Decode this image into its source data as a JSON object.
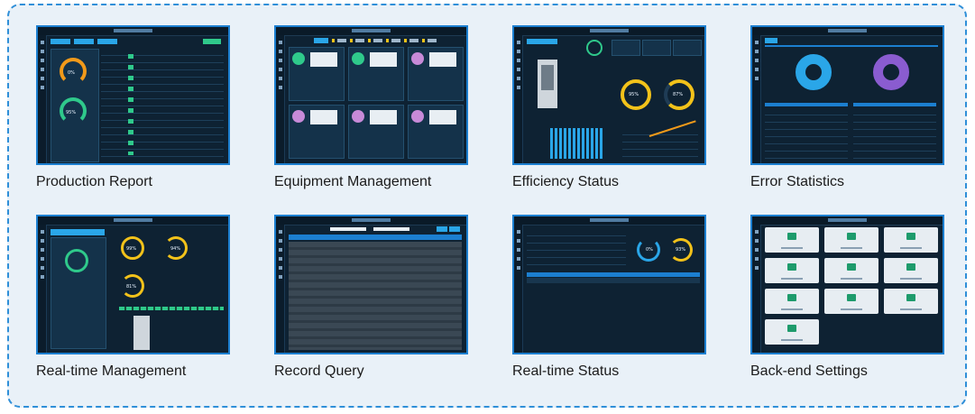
{
  "tiles": [
    {
      "id": "production-report",
      "caption": "Production Report",
      "percent_a": "0%",
      "percent_b": "95%"
    },
    {
      "id": "equipment-management",
      "caption": "Equipment Management"
    },
    {
      "id": "efficiency-status",
      "caption": "Efficiency Status",
      "percent_a": "95%",
      "percent_b": "87%"
    },
    {
      "id": "error-statistics",
      "caption": "Error Statistics"
    },
    {
      "id": "real-time-management",
      "caption": "Real-time Management",
      "percent_a": "99%",
      "percent_b": "94%",
      "percent_c": "81%"
    },
    {
      "id": "record-query",
      "caption": "Record Query"
    },
    {
      "id": "real-time-status",
      "caption": "Real-time Status",
      "percent_a": "0%",
      "percent_b": "93%"
    },
    {
      "id": "back-end-settings",
      "caption": "Back-end Settings"
    }
  ],
  "colors": {
    "frame": "#2f8fd8",
    "panel_bg": "#e9f1f8",
    "screen_bg": "#0e2233",
    "gauge_yellow": "#f2c21a",
    "gauge_green": "#2fc98b",
    "accent_blue": "#2aa6e8"
  }
}
